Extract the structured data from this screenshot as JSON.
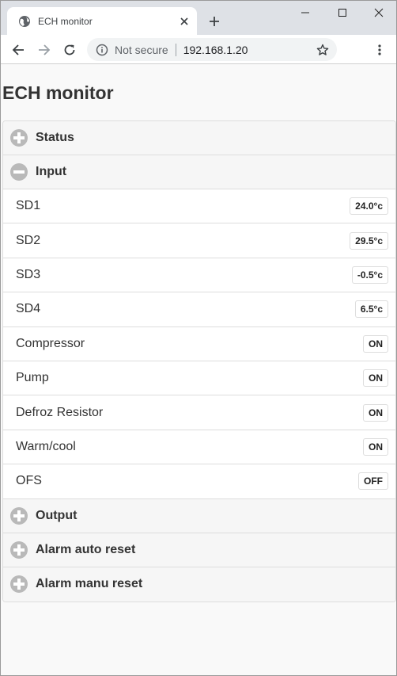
{
  "browser": {
    "tab_title": "ECH monitor",
    "omnibox_security": "Not secure",
    "omnibox_url": "192.168.1.20",
    "icons": {
      "favicon": "globe-icon",
      "tab_close": "close-icon",
      "new_tab": "plus-icon",
      "back": "arrow-left-icon",
      "forward": "arrow-right-icon",
      "reload": "reload-icon",
      "info": "info-icon",
      "star": "star-icon",
      "menu": "kebab-menu-icon"
    }
  },
  "page": {
    "title": "ECH monitor"
  },
  "accordion": {
    "status": {
      "label": "Status",
      "expanded": false
    },
    "input": {
      "label": "Input",
      "expanded": true,
      "rows": [
        {
          "label": "SD1",
          "value": "24.0°c"
        },
        {
          "label": "SD2",
          "value": "29.5°c"
        },
        {
          "label": "SD3",
          "value": "-0.5°c"
        },
        {
          "label": "SD4",
          "value": "6.5°c"
        },
        {
          "label": "Compressor",
          "value": "ON"
        },
        {
          "label": "Pump",
          "value": "ON"
        },
        {
          "label": "Defroz Resistor",
          "value": "ON"
        },
        {
          "label": "Warm/cool",
          "value": "ON"
        },
        {
          "label": "OFS",
          "value": "OFF"
        }
      ]
    },
    "output": {
      "label": "Output",
      "expanded": false
    },
    "alarm_auto": {
      "label": "Alarm auto reset",
      "expanded": false
    },
    "alarm_manu": {
      "label": "Alarm manu reset",
      "expanded": false
    }
  },
  "colors": {
    "accordion_icon": "#b9b9b9",
    "header_bg": "#f6f6f6",
    "tabstrip_bg": "#dee1e6"
  }
}
